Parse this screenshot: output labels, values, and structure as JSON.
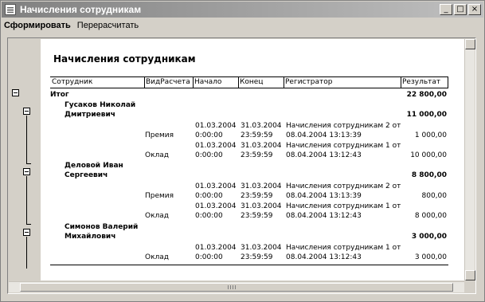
{
  "window": {
    "title": "Начисления сотрудникам",
    "btn_min": "_",
    "btn_max": "□",
    "btn_close": "×"
  },
  "menu": {
    "form": "Сформировать",
    "recalc": "Перерасчитать"
  },
  "report": {
    "title": "Начисления сотрудникам",
    "headers": {
      "employee": "Сотрудник",
      "type": "ВидРасчета",
      "start": "Начало",
      "end": "Конец",
      "registrar": "Регистратор",
      "result": "Результат"
    },
    "total": {
      "label": "Итог",
      "value": "22 800,00"
    },
    "employees": [
      {
        "name1": "Гусаков Николай",
        "name2": "Дмитриевич",
        "total": "11 000,00",
        "rows": [
          {
            "type": "Премия",
            "start1": "01.03.2004",
            "start2": "0:00:00",
            "end1": "31.03.2004",
            "end2": "23:59:59",
            "reg1": "Начисления сотрудникам 2 от",
            "reg2": "08.04.2004 13:13:39",
            "value": "1 000,00"
          },
          {
            "type": "Оклад",
            "start1": "01.03.2004",
            "start2": "0:00:00",
            "end1": "31.03.2004",
            "end2": "23:59:59",
            "reg1": "Начисления сотрудникам 1 от",
            "reg2": "08.04.2004 13:12:43",
            "value": "10 000,00"
          }
        ]
      },
      {
        "name1": "Деловой Иван",
        "name2": "Сергеевич",
        "total": "8 800,00",
        "rows": [
          {
            "type": "Премия",
            "start1": "01.03.2004",
            "start2": "0:00:00",
            "end1": "31.03.2004",
            "end2": "23:59:59",
            "reg1": "Начисления сотрудникам 2 от",
            "reg2": "08.04.2004 13:13:39",
            "value": "800,00"
          },
          {
            "type": "Оклад",
            "start1": "01.03.2004",
            "start2": "0:00:00",
            "end1": "31.03.2004",
            "end2": "23:59:59",
            "reg1": "Начисления сотрудникам 1 от",
            "reg2": "08.04.2004 13:12:43",
            "value": "8 000,00"
          }
        ]
      },
      {
        "name1": "Симонов Валерий",
        "name2": "Михайлович",
        "total": "3 000,00",
        "rows": [
          {
            "type": "Оклад",
            "start1": "01.03.2004",
            "start2": "0:00:00",
            "end1": "31.03.2004",
            "end2": "23:59:59",
            "reg1": "Начисления сотрудникам 1 от",
            "reg2": "08.04.2004 13:12:43",
            "value": "3 000,00"
          }
        ]
      }
    ]
  }
}
